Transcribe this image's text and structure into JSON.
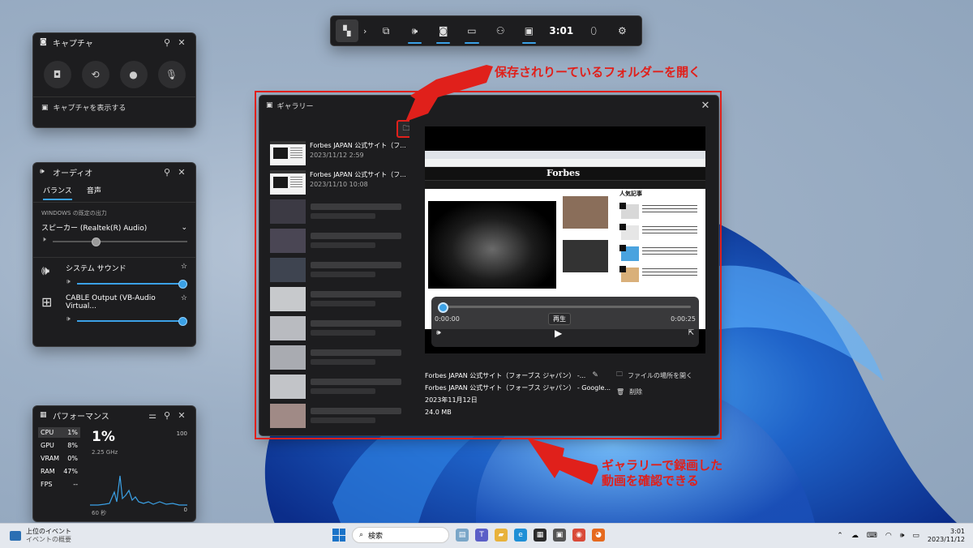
{
  "topbar": {
    "time": "3:01"
  },
  "capture": {
    "title": "キャプチャ",
    "show_link": "キャプチャを表示する"
  },
  "audio": {
    "title": "オーディオ",
    "tabs": [
      "バランス",
      "音声"
    ],
    "default_output_label": "WINDOWS の既定の出力",
    "device": "スピーカー (Realtek(R) Audio)",
    "apps": [
      {
        "name": "システム サウンド",
        "level": 1.0
      },
      {
        "name": "CABLE Output (VB-Audio Virtual...",
        "level": 1.0
      }
    ]
  },
  "performance": {
    "title": "パフォーマンス",
    "metrics": [
      {
        "label": "CPU",
        "value": "1%"
      },
      {
        "label": "GPU",
        "value": "8%"
      },
      {
        "label": "VRAM",
        "value": "0%"
      },
      {
        "label": "RAM",
        "value": "47%"
      },
      {
        "label": "FPS",
        "value": "--"
      }
    ],
    "big_value": "1%",
    "clock": "2.25 GHz",
    "max_label": "100",
    "min_label": "0",
    "duration_label": "60 秒"
  },
  "gallery": {
    "title": "ギャラリー",
    "items": [
      {
        "title": "Forbes JAPAN 公式サイト（フ...",
        "date": "2023/11/12 2:59"
      },
      {
        "title": "Forbes JAPAN 公式サイト（フ...",
        "date": "2023/11/10 10:08"
      }
    ],
    "player": {
      "current": "0:00:00",
      "total": "0:00:25",
      "tooltip": "再生",
      "progress": 0.0
    },
    "preview": {
      "logo": "Forbes",
      "sidebar_heading": "人気記事"
    },
    "info": {
      "line1": "Forbes JAPAN 公式サイト（フォーブス ジャパン） -...",
      "line2": "Forbes JAPAN 公式サイト（フォーブス ジャパン） - Google...",
      "date": "2023年11月12日",
      "size": "24.0 MB"
    },
    "actions": {
      "open_location": "ファイルの場所を開く",
      "delete": "削除"
    }
  },
  "annotations": {
    "note_top": "保存されりーているフォルダーを開く",
    "note_bottom_1": "ギャラリーで録画した",
    "note_bottom_2": "動画を確認できる"
  },
  "taskbar": {
    "news_1": "上位のイベント",
    "news_2": "イベントの概要",
    "search_placeholder": "検索",
    "clock_time": "3:01",
    "clock_date": "2023/11/12"
  }
}
